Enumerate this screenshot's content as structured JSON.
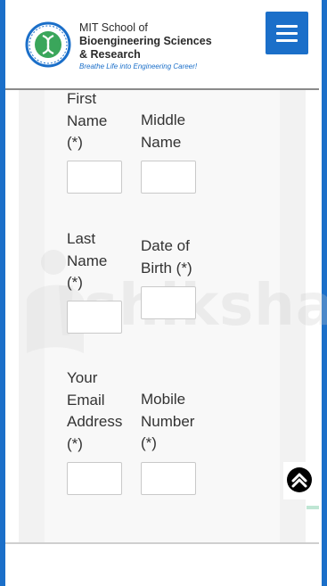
{
  "header": {
    "logo_line1": "MIT School of",
    "logo_line2": "Bioengineering Sciences",
    "logo_line3": "& Research",
    "logo_tagline": "Breathe Life into Engineering Career!"
  },
  "colors": {
    "brand_blue": "#1b6fc9",
    "header_rule": "#8a8a8a"
  },
  "icons": {
    "menu": "hamburger-menu-icon",
    "scroll_top": "chevron-up-circle-icon"
  },
  "form": {
    "first_name_label": "First Name (*)",
    "middle_name_label": "Middle Name",
    "last_name_label": "Last Name (*)",
    "dob_label": "Date of Birth (*)",
    "email_label": "Your Email Address (*)",
    "mobile_label": "Mobile Number (*)",
    "first_name_value": "",
    "middle_name_value": "",
    "last_name_value": "",
    "dob_value": "",
    "email_value": "",
    "mobile_value": ""
  },
  "watermark": {
    "text": "shiksha"
  }
}
